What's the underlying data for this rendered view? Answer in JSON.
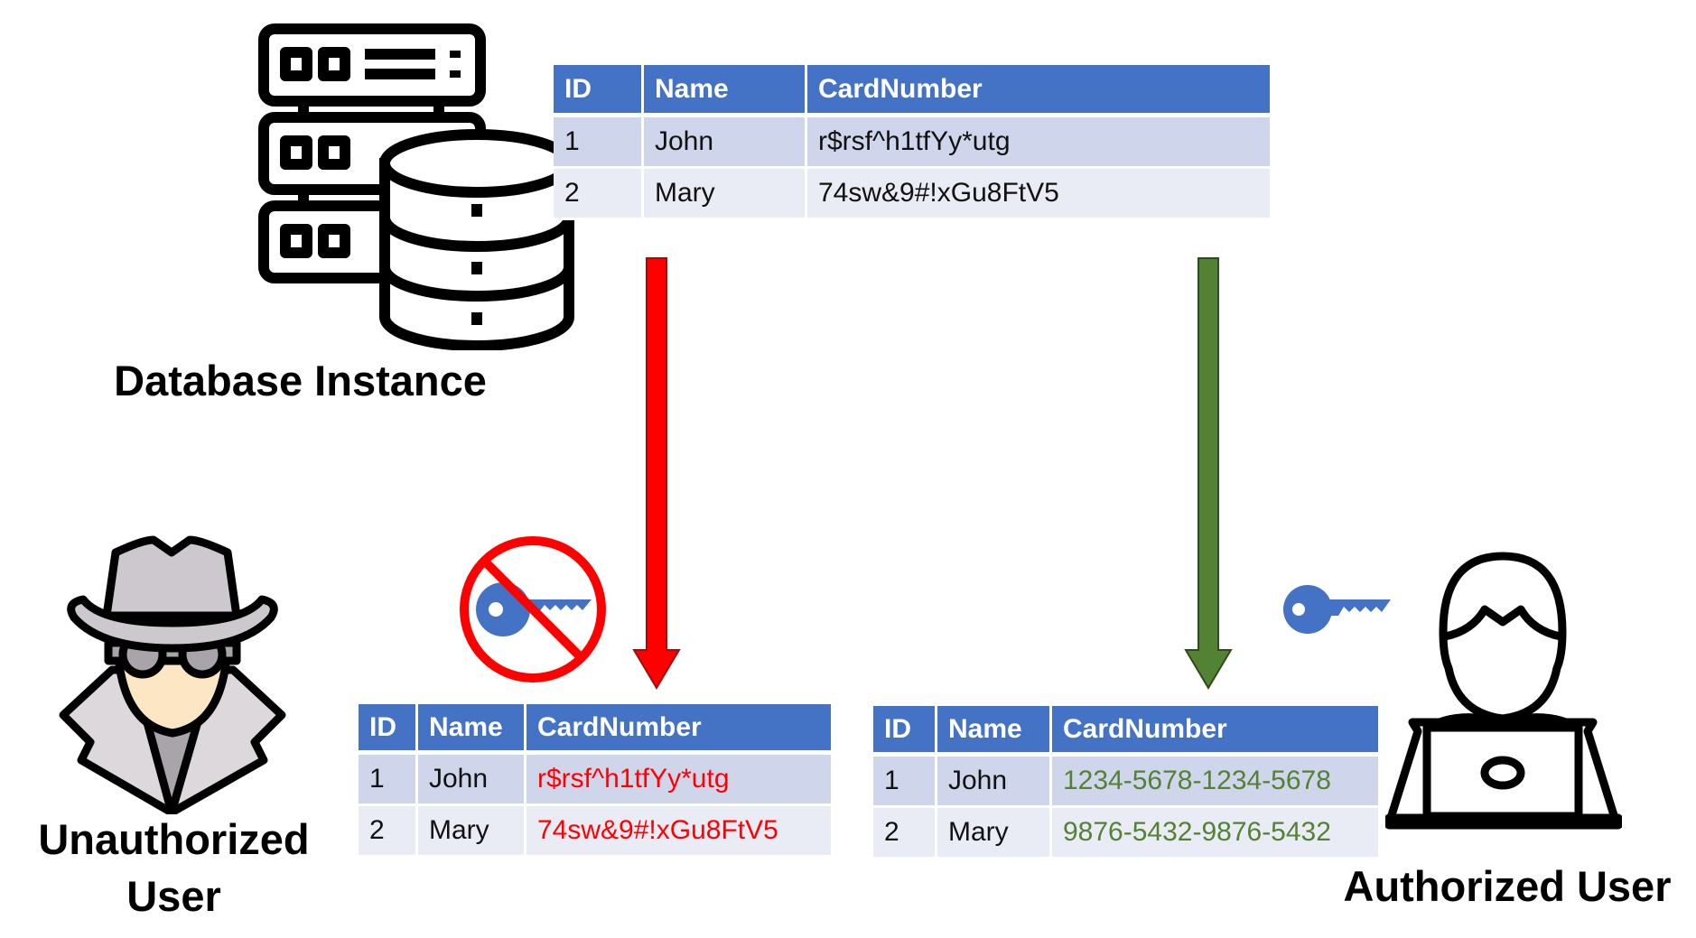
{
  "colors": {
    "header": "#4472C4",
    "row_odd": "#CFD5EA",
    "row_even": "#E9EBF5",
    "denied": "#FF0000",
    "granted": "#548235",
    "key": "#4472C4"
  },
  "labels": {
    "database": "Database Instance",
    "unauthorized_line1": "Unauthorized",
    "unauthorized_line2": "User",
    "authorized": "Authorized User"
  },
  "columns": [
    "ID",
    "Name",
    "CardNumber"
  ],
  "tables": {
    "database": {
      "rows": [
        [
          "1",
          "John",
          "r$rsf^h1tfYy*utg"
        ],
        [
          "2",
          "Mary",
          "74sw&9#!xGu8FtV5"
        ]
      ]
    },
    "unauthorized": {
      "rows": [
        [
          "1",
          "John",
          "r$rsf^h1tfYy*utg"
        ],
        [
          "2",
          "Mary",
          "74sw&9#!xGu8FtV5"
        ]
      ]
    },
    "authorized": {
      "rows": [
        [
          "1",
          "John",
          "1234-5678-1234-5678"
        ],
        [
          "2",
          "Mary",
          "9876-5432-9876-5432"
        ]
      ]
    }
  },
  "icons": [
    "database-server-icon",
    "spy-icon",
    "no-key-icon",
    "key-icon",
    "user-laptop-icon",
    "arrow-down-icon"
  ]
}
